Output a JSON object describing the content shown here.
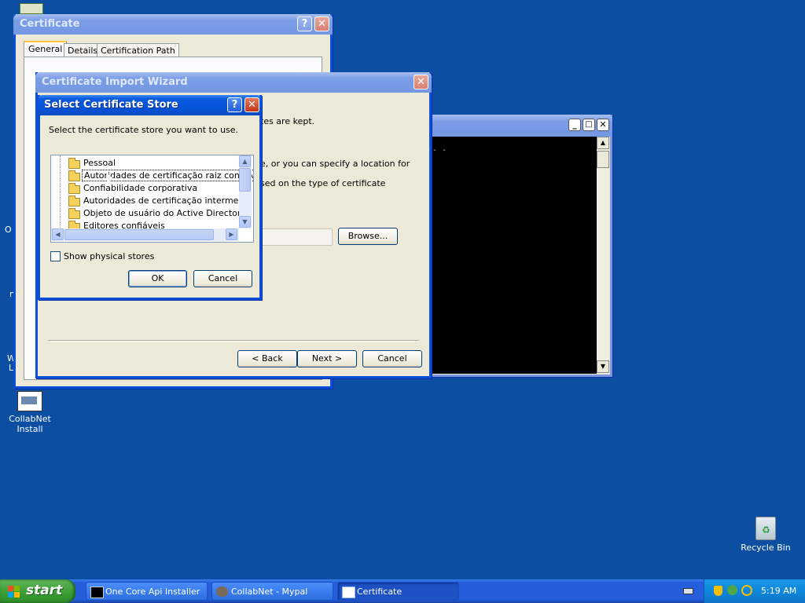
{
  "desktop": {
    "icons": [
      {
        "label_line1": "CollabNet",
        "label_line2": "Install"
      },
      {
        "label": "Recycle Bin"
      }
    ],
    "partial_labels": [
      "O",
      "n",
      "W",
      "L"
    ]
  },
  "certificate_window": {
    "title": "Certificate",
    "tabs": [
      "General",
      "Details",
      "Certification Path"
    ],
    "active_tab": "General"
  },
  "import_wizard": {
    "title": "Certificate Import Wizard",
    "text_line1": "tes are kept.",
    "text_line2": "e, or you can specify a location for",
    "text_line3": "sed on the type of certificate",
    "browse_label": "Browse...",
    "back_label": "< Back",
    "next_label": "Next >",
    "cancel_label": "Cancel"
  },
  "console_window": {
    "text": "- -"
  },
  "select_store_dialog": {
    "title": "Select Certificate Store",
    "prompt": "Select the certificate store you want to use.",
    "items": [
      "Pessoal",
      "Autoridades de certificação raiz confiáveis",
      "Confiabilidade corporativa",
      "Autoridades de certificação intermediárias",
      "Objeto de usuário do Active Directory",
      "Editores confiáveis"
    ],
    "selected_index": 1,
    "show_physical_label": "Show physical stores",
    "show_physical_checked": false,
    "ok_label": "OK",
    "cancel_label": "Cancel"
  },
  "taskbar": {
    "start_label": "start",
    "tasks": [
      {
        "label": "One Core Api Installer"
      },
      {
        "label": "CollabNet - Mypal"
      },
      {
        "label": "Certificate"
      }
    ],
    "active_task": "Certificate",
    "clock": "5:19 AM"
  },
  "colors": {
    "desktop": "#0b4ea2",
    "titlebar": "#0654d9",
    "start": "#3a9c33",
    "taskbar": "#245edb"
  }
}
